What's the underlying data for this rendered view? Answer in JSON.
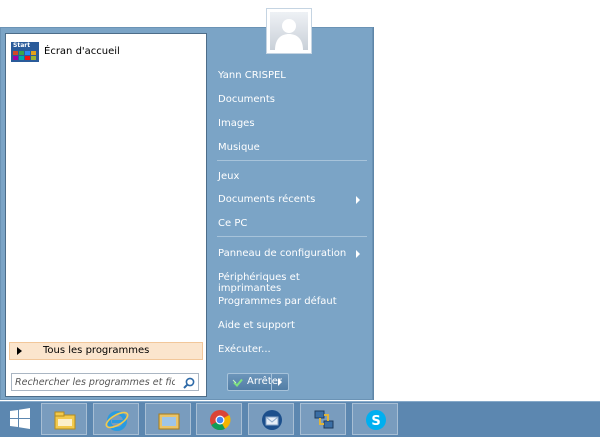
{
  "start_menu": {
    "pinned": [
      {
        "label": "Écran d'accueil",
        "icon": "start-screen-tile-icon",
        "tile_label": "Start"
      }
    ],
    "all_programs_label": "Tous les programmes",
    "search_placeholder": "Rechercher les programmes et fichiers"
  },
  "user": {
    "name": "Yann CRISPEL"
  },
  "right_items": [
    {
      "label": "Documents",
      "submenu": false
    },
    {
      "label": "Images",
      "submenu": false
    },
    {
      "label": "Musique",
      "submenu": false
    },
    {
      "label": "Jeux",
      "submenu": false
    },
    {
      "label": "Documents récents",
      "submenu": true
    },
    {
      "label": "Ce PC",
      "submenu": false
    },
    {
      "label": "Panneau de configuration",
      "submenu": true
    },
    {
      "label": "Périphériques et imprimantes",
      "submenu": false
    },
    {
      "label": "Programmes par défaut",
      "submenu": false
    },
    {
      "label": "Aide et support",
      "submenu": false
    },
    {
      "label": "Exécuter...",
      "submenu": false
    }
  ],
  "shutdown": {
    "label": "Arrêter"
  },
  "taskbar": {
    "apps": [
      {
        "icon": "file-explorer-icon"
      },
      {
        "icon": "internet-explorer-icon"
      },
      {
        "icon": "folder-icon"
      },
      {
        "icon": "chrome-icon"
      },
      {
        "icon": "thunderbird-icon"
      },
      {
        "icon": "network-icon"
      },
      {
        "icon": "skype-icon"
      }
    ]
  },
  "colors": {
    "menu_bg": "#7ba4c6",
    "taskbar_bg": "#5c87b0",
    "all_programs_highlight": "#fbe5cd"
  }
}
